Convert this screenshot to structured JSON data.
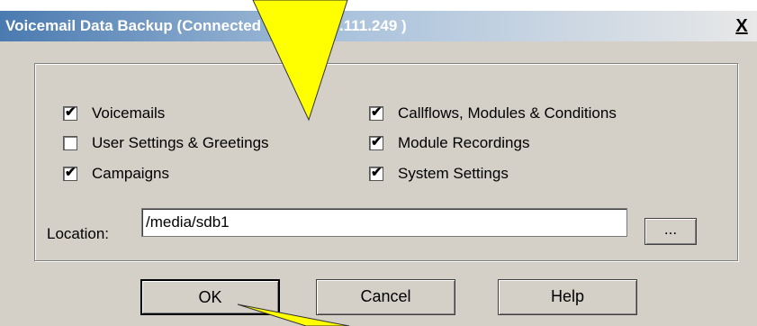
{
  "dialog": {
    "title": "Voicemail Data Backup (Connected to 192.168.111.249 )",
    "close_label": "X"
  },
  "options": {
    "left": [
      {
        "label": "Voicemails",
        "checked": true
      },
      {
        "label": "User Settings & Greetings",
        "checked": false
      },
      {
        "label": "Campaigns",
        "checked": true
      }
    ],
    "right": [
      {
        "label": "Callflows, Modules & Conditions",
        "checked": true
      },
      {
        "label": "Module Recordings",
        "checked": true
      },
      {
        "label": "System Settings",
        "checked": true
      }
    ]
  },
  "location": {
    "label": "Location:",
    "value": "/media/sdb1",
    "browse_label": "..."
  },
  "buttons": {
    "ok": "OK",
    "cancel": "Cancel",
    "help": "Help"
  },
  "colors": {
    "annotation_arrow": "#ffff00"
  }
}
